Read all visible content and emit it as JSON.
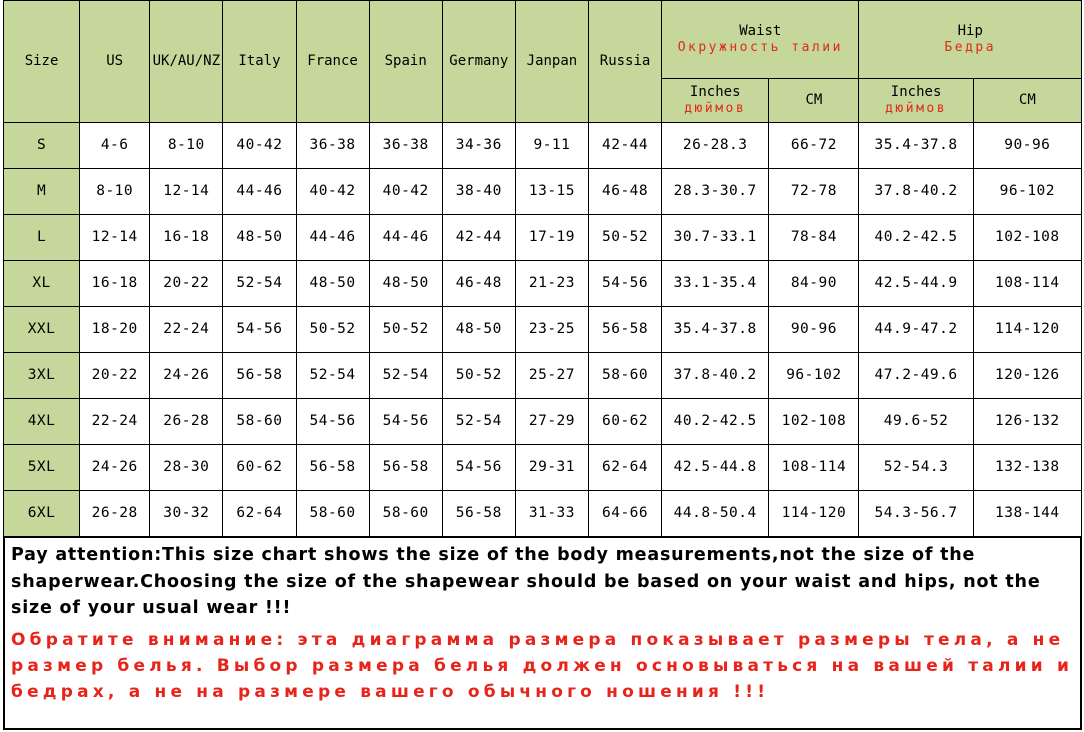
{
  "table": {
    "columns": [
      {
        "key": "size",
        "label": "Size"
      },
      {
        "key": "us",
        "label": "US"
      },
      {
        "key": "uk",
        "label": "UK/AU/NZ"
      },
      {
        "key": "italy",
        "label": "Italy"
      },
      {
        "key": "france",
        "label": "France"
      },
      {
        "key": "spain",
        "label": "Spain"
      },
      {
        "key": "germany",
        "label": "Germany"
      },
      {
        "key": "japan",
        "label": "Janpan"
      },
      {
        "key": "russia",
        "label": "Russia"
      }
    ],
    "groups": {
      "waist": {
        "label_en": "Waist",
        "label_ru": "Окружность талии",
        "sub": [
          {
            "label_en": "Inches",
            "label_ru": "дюймов"
          },
          {
            "label_en": "CM",
            "label_ru": ""
          }
        ]
      },
      "hip": {
        "label_en": "Hip",
        "label_ru": "Бедра",
        "sub": [
          {
            "label_en": "Inches",
            "label_ru": "дюймов"
          },
          {
            "label_en": "CM",
            "label_ru": ""
          }
        ]
      }
    },
    "rows": [
      {
        "size": "S",
        "us": "4-6",
        "uk": "8-10",
        "italy": "40-42",
        "france": "36-38",
        "spain": "36-38",
        "germany": "34-36",
        "japan": "9-11",
        "russia": "42-44",
        "waist_in": "26-28.3",
        "waist_cm": "66-72",
        "hip_in": "35.4-37.8",
        "hip_cm": "90-96"
      },
      {
        "size": "M",
        "us": "8-10",
        "uk": "12-14",
        "italy": "44-46",
        "france": "40-42",
        "spain": "40-42",
        "germany": "38-40",
        "japan": "13-15",
        "russia": "46-48",
        "waist_in": "28.3-30.7",
        "waist_cm": "72-78",
        "hip_in": "37.8-40.2",
        "hip_cm": "96-102"
      },
      {
        "size": "L",
        "us": "12-14",
        "uk": "16-18",
        "italy": "48-50",
        "france": "44-46",
        "spain": "44-46",
        "germany": "42-44",
        "japan": "17-19",
        "russia": "50-52",
        "waist_in": "30.7-33.1",
        "waist_cm": "78-84",
        "hip_in": "40.2-42.5",
        "hip_cm": "102-108"
      },
      {
        "size": "XL",
        "us": "16-18",
        "uk": "20-22",
        "italy": "52-54",
        "france": "48-50",
        "spain": "48-50",
        "germany": "46-48",
        "japan": "21-23",
        "russia": "54-56",
        "waist_in": "33.1-35.4",
        "waist_cm": "84-90",
        "hip_in": "42.5-44.9",
        "hip_cm": "108-114"
      },
      {
        "size": "XXL",
        "us": "18-20",
        "uk": "22-24",
        "italy": "54-56",
        "france": "50-52",
        "spain": "50-52",
        "germany": "48-50",
        "japan": "23-25",
        "russia": "56-58",
        "waist_in": "35.4-37.8",
        "waist_cm": "90-96",
        "hip_in": "44.9-47.2",
        "hip_cm": "114-120"
      },
      {
        "size": "3XL",
        "us": "20-22",
        "uk": "24-26",
        "italy": "56-58",
        "france": "52-54",
        "spain": "52-54",
        "germany": "50-52",
        "japan": "25-27",
        "russia": "58-60",
        "waist_in": "37.8-40.2",
        "waist_cm": "96-102",
        "hip_in": "47.2-49.6",
        "hip_cm": "120-126"
      },
      {
        "size": "4XL",
        "us": "22-24",
        "uk": "26-28",
        "italy": "58-60",
        "france": "54-56",
        "spain": "54-56",
        "germany": "52-54",
        "japan": "27-29",
        "russia": "60-62",
        "waist_in": "40.2-42.5",
        "waist_cm": "102-108",
        "hip_in": "49.6-52",
        "hip_cm": "126-132"
      },
      {
        "size": "5XL",
        "us": "24-26",
        "uk": "28-30",
        "italy": "60-62",
        "france": "56-58",
        "spain": "56-58",
        "germany": "54-56",
        "japan": "29-31",
        "russia": "62-64",
        "waist_in": "42.5-44.8",
        "waist_cm": "108-114",
        "hip_in": "52-54.3",
        "hip_cm": "132-138"
      },
      {
        "size": "6XL",
        "us": "26-28",
        "uk": "30-32",
        "italy": "62-64",
        "france": "58-60",
        "spain": "58-60",
        "germany": "56-58",
        "japan": "31-33",
        "russia": "64-66",
        "waist_in": "44.8-50.4",
        "waist_cm": "114-120",
        "hip_in": "54.3-56.7",
        "hip_cm": "138-144"
      }
    ]
  },
  "footer": {
    "note_en": "Pay attention:This size chart shows the size of the body measurements,not the size of the shaperwear.Choosing the size of the shapewear should be based on your waist and hips, not the size of your usual wear !!!",
    "note_ru": "Обратите внимание: эта диаграмма размера показывает размеры тела, а не размер белья. Выбор размера белья должен основываться на вашей талии и бедрах, а не на размере вашего обычного ношения !!!"
  },
  "colors": {
    "header_green": "#c5d79a",
    "accent_red": "#e8231a",
    "text_black": "#000000"
  }
}
